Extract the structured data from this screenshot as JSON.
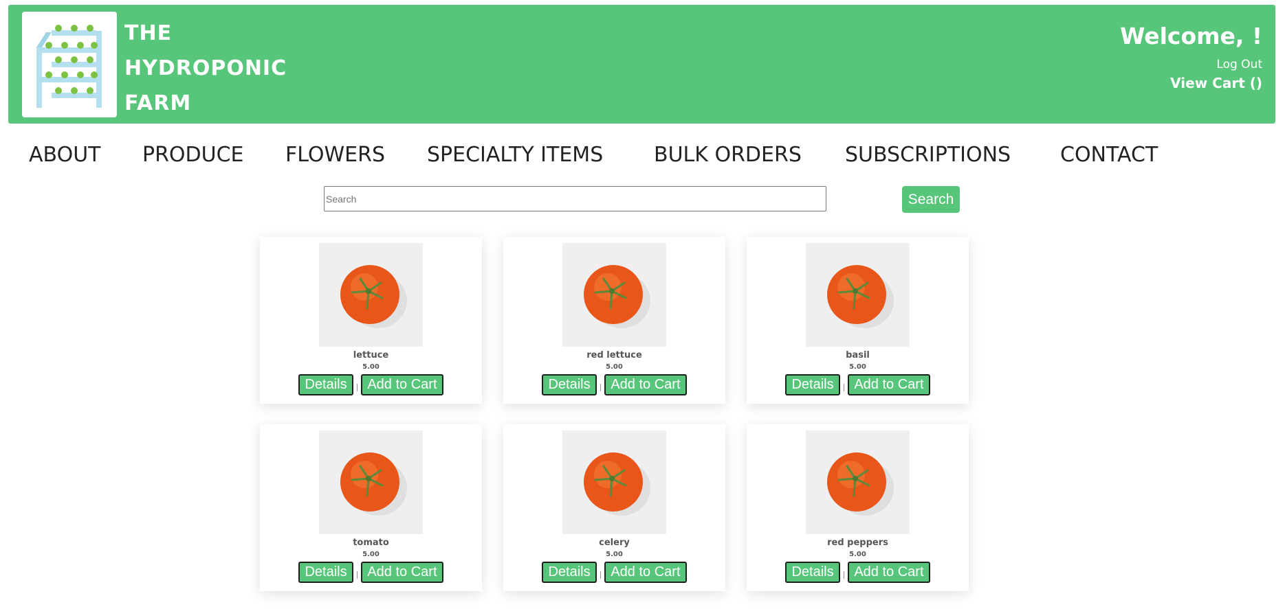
{
  "header": {
    "brand_lines": [
      "THE",
      "HYDROPONIC",
      "FARM"
    ],
    "welcome": "Welcome, !",
    "logout": "Log Out",
    "view_cart": "View Cart ()",
    "accent": "#57c67a"
  },
  "nav": {
    "items": [
      {
        "label": "ABOUT"
      },
      {
        "label": "PRODUCE"
      },
      {
        "label": "FLOWERS"
      },
      {
        "label": "SPECIALTY ITEMS"
      },
      {
        "label": "BULK ORDERS"
      },
      {
        "label": "SUBSCRIPTIONS"
      },
      {
        "label": "CONTACT"
      }
    ]
  },
  "search": {
    "placeholder": "Search",
    "button": "Search"
  },
  "products": [
    {
      "name": "lettuce",
      "price": "5.00",
      "details": "Details",
      "sep": "|",
      "add": "Add to Cart"
    },
    {
      "name": "red lettuce",
      "price": "5.00",
      "details": "Details",
      "sep": "|",
      "add": "Add to Cart"
    },
    {
      "name": "basil",
      "price": "5.00",
      "details": "Details",
      "sep": "|",
      "add": "Add to Cart"
    },
    {
      "name": "tomato",
      "price": "5.00",
      "details": "Details",
      "sep": "|",
      "add": "Add to Cart"
    },
    {
      "name": "celery",
      "price": "5.00",
      "details": "Details",
      "sep": "|",
      "add": "Add to Cart"
    },
    {
      "name": "red peppers",
      "price": "5.00",
      "details": "Details",
      "sep": "|",
      "add": "Add to Cart"
    }
  ]
}
